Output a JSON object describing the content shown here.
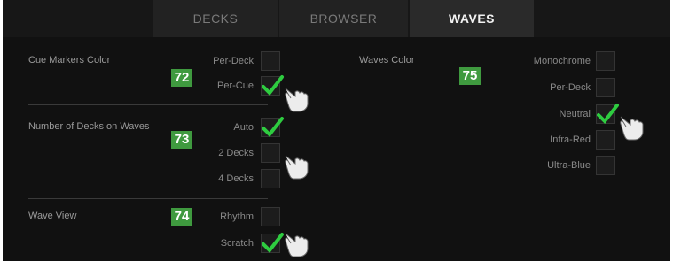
{
  "tabs": [
    {
      "label": "DECKS",
      "active": false
    },
    {
      "label": "BROWSER",
      "active": false
    },
    {
      "label": "WAVES",
      "active": true
    }
  ],
  "sections": {
    "cue_markers": {
      "label": "Cue Markers Color",
      "badge": "72",
      "options": [
        {
          "label": "Per-Deck",
          "checked": false
        },
        {
          "label": "Per-Cue",
          "checked": true
        }
      ]
    },
    "decks_on_waves": {
      "label": "Number of Decks on Waves",
      "badge": "73",
      "options": [
        {
          "label": "Auto",
          "checked": true
        },
        {
          "label": "2 Decks",
          "checked": false
        },
        {
          "label": "4 Decks",
          "checked": false
        }
      ]
    },
    "wave_view": {
      "label": "Wave View",
      "badge": "74",
      "options": [
        {
          "label": "Rhythm",
          "checked": false
        },
        {
          "label": "Scratch",
          "checked": true
        }
      ]
    },
    "waves_color": {
      "label": "Waves Color",
      "badge": "75",
      "options": [
        {
          "label": "Monochrome",
          "checked": false
        },
        {
          "label": "Per-Deck",
          "checked": false
        },
        {
          "label": "Neutral",
          "checked": true
        },
        {
          "label": "Infra-Red",
          "checked": false
        },
        {
          "label": "Ultra-Blue",
          "checked": false
        }
      ]
    }
  },
  "colors": {
    "badge": "#3f9a3f",
    "check": "#2ecc40",
    "background": "#111111",
    "tab_active": "#2a2a2a"
  },
  "icons": {
    "pointer": "pointing-hand-icon",
    "check": "checkmark-icon"
  }
}
